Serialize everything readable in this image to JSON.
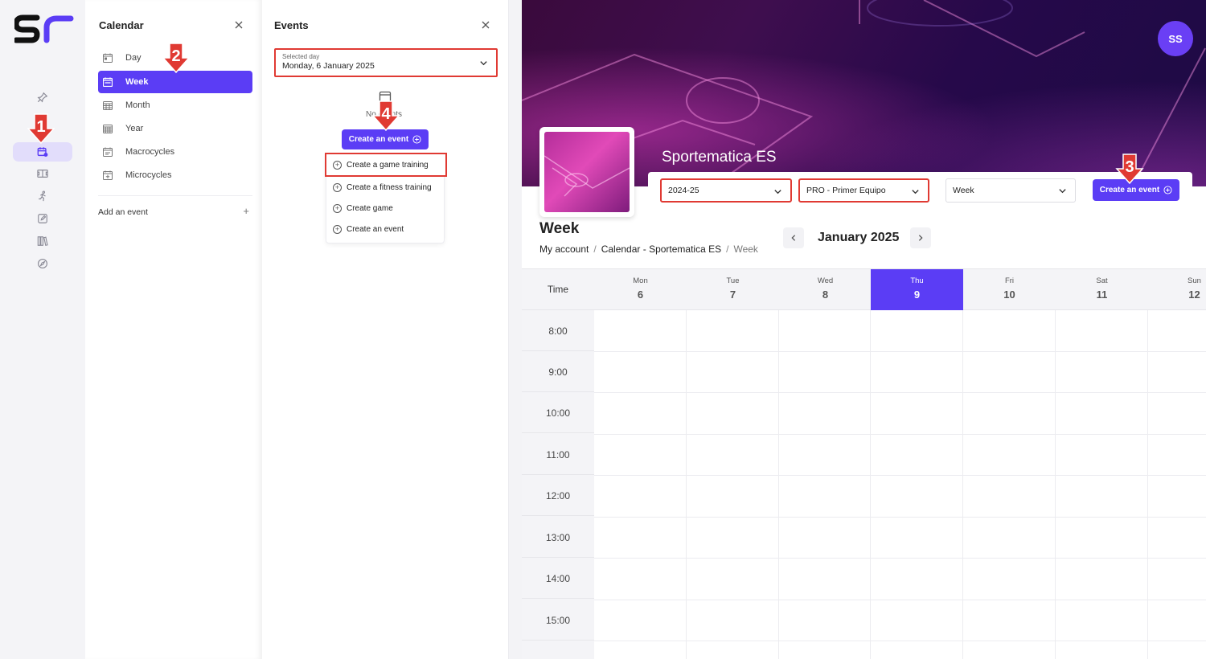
{
  "rail": {
    "items": [
      {
        "name": "pin-icon"
      },
      {
        "name": "calendar-icon",
        "active": true
      },
      {
        "name": "field-icon"
      },
      {
        "name": "runner-icon"
      },
      {
        "name": "edit-icon"
      },
      {
        "name": "library-icon"
      },
      {
        "name": "compass-icon"
      }
    ]
  },
  "calendar_panel": {
    "title": "Calendar",
    "items": [
      {
        "label": "Day",
        "icon": "calendar-day-icon"
      },
      {
        "label": "Week",
        "icon": "calendar-week-icon",
        "active": true
      },
      {
        "label": "Month",
        "icon": "calendar-month-icon"
      },
      {
        "label": "Year",
        "icon": "calendar-year-icon"
      },
      {
        "label": "Macrocycles",
        "icon": "calendar-macro-icon"
      },
      {
        "label": "Microcycles",
        "icon": "calendar-micro-icon"
      }
    ],
    "add_event_label": "Add an event",
    "add_event_plus": "+"
  },
  "events_panel": {
    "title": "Events",
    "selected_day_label": "Selected day",
    "selected_day_value": "Monday, 6 January 2025",
    "no_events_text": "No events",
    "create_button_label": "Create an event",
    "menu": [
      "Create a game training",
      "Create a fitness training",
      "Create game",
      "Create an event"
    ]
  },
  "main": {
    "avatar_initials": "SS",
    "team_name": "Sportematica ES",
    "filters": {
      "season": "2024-25",
      "team": "PRO - Primer Equipo",
      "view": "Week"
    },
    "create_button_label": "Create an event",
    "view_title": "Week",
    "breadcrumb": [
      "My account",
      "Calendar - Sportematica ES",
      "Week"
    ],
    "breadcrumb_sep": "/",
    "month_label": "January 2025",
    "grid": {
      "time_header": "Time",
      "days": [
        {
          "name": "Mon",
          "date": "6"
        },
        {
          "name": "Tue",
          "date": "7"
        },
        {
          "name": "Wed",
          "date": "8"
        },
        {
          "name": "Thu",
          "date": "9",
          "today": true
        },
        {
          "name": "Fri",
          "date": "10"
        },
        {
          "name": "Sat",
          "date": "11"
        },
        {
          "name": "Sun",
          "date": "12"
        }
      ],
      "times": [
        "8:00",
        "9:00",
        "10:00",
        "11:00",
        "12:00",
        "13:00",
        "14:00",
        "15:00"
      ]
    }
  },
  "annotations": [
    "1",
    "2",
    "3",
    "4"
  ],
  "colors": {
    "accent": "#5b3df5",
    "highlight": "#e03a33"
  }
}
